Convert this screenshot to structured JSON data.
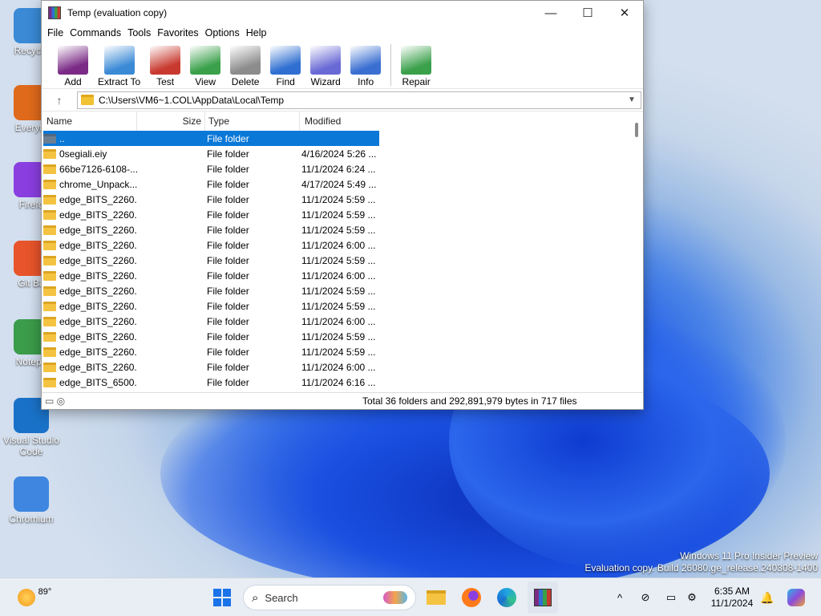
{
  "desktop": {
    "icons": [
      {
        "label": "Recycle",
        "icon": "recycle-bin-icon"
      },
      {
        "label": "Everyth",
        "icon": "everything-search-icon"
      },
      {
        "label": "Firefo",
        "icon": "firefox-icon"
      },
      {
        "label": "Git Ba",
        "icon": "git-bash-icon"
      },
      {
        "label": "Notepa",
        "icon": "notepad-icon"
      },
      {
        "label": "Visual Studio Code",
        "icon": "vscode-icon"
      },
      {
        "label": "Chromium",
        "icon": "chromium-icon"
      }
    ],
    "watermark_line1": "Windows 11 Pro Insider Preview",
    "watermark_line2": "Evaluation copy. Build 26080.ge_release.240308-1400"
  },
  "window": {
    "title": "Temp (evaluation copy)",
    "controls": {
      "minimize": "—",
      "maximize": "☐",
      "close": "✕"
    },
    "menu": [
      "File",
      "Commands",
      "Tools",
      "Favorites",
      "Options",
      "Help"
    ],
    "toolbar": [
      {
        "label": "Add",
        "icon": "add-archive-icon"
      },
      {
        "label": "Extract To",
        "icon": "extract-icon"
      },
      {
        "label": "Test",
        "icon": "test-icon"
      },
      {
        "label": "View",
        "icon": "view-book-icon"
      },
      {
        "label": "Delete",
        "icon": "trash-icon"
      },
      {
        "label": "Find",
        "icon": "magnifier-icon"
      },
      {
        "label": "Wizard",
        "icon": "wizard-wand-icon"
      },
      {
        "label": "Info",
        "icon": "info-icon"
      },
      {
        "label": "Repair",
        "icon": "repair-icon"
      }
    ],
    "address": "C:\\Users\\VM6~1.COL\\AppData\\Local\\Temp",
    "columns": {
      "name": "Name",
      "size": "Size",
      "type": "Type",
      "modified": "Modified"
    },
    "files": [
      {
        "name": "..",
        "size": "",
        "type": "File folder",
        "modified": "",
        "selected": true
      },
      {
        "name": "0segiali.eiy",
        "size": "",
        "type": "File folder",
        "modified": "4/16/2024 5:26 ..."
      },
      {
        "name": "66be7126-6108-...",
        "size": "",
        "type": "File folder",
        "modified": "11/1/2024 6:24 ..."
      },
      {
        "name": "chrome_Unpack...",
        "size": "",
        "type": "File folder",
        "modified": "4/17/2024 5:49 ..."
      },
      {
        "name": "edge_BITS_2260...",
        "size": "",
        "type": "File folder",
        "modified": "11/1/2024 5:59 ..."
      },
      {
        "name": "edge_BITS_2260...",
        "size": "",
        "type": "File folder",
        "modified": "11/1/2024 5:59 ..."
      },
      {
        "name": "edge_BITS_2260...",
        "size": "",
        "type": "File folder",
        "modified": "11/1/2024 5:59 ..."
      },
      {
        "name": "edge_BITS_2260...",
        "size": "",
        "type": "File folder",
        "modified": "11/1/2024 6:00 ..."
      },
      {
        "name": "edge_BITS_2260...",
        "size": "",
        "type": "File folder",
        "modified": "11/1/2024 5:59 ..."
      },
      {
        "name": "edge_BITS_2260...",
        "size": "",
        "type": "File folder",
        "modified": "11/1/2024 6:00 ..."
      },
      {
        "name": "edge_BITS_2260...",
        "size": "",
        "type": "File folder",
        "modified": "11/1/2024 5:59 ..."
      },
      {
        "name": "edge_BITS_2260...",
        "size": "",
        "type": "File folder",
        "modified": "11/1/2024 5:59 ..."
      },
      {
        "name": "edge_BITS_2260...",
        "size": "",
        "type": "File folder",
        "modified": "11/1/2024 6:00 ..."
      },
      {
        "name": "edge_BITS_2260...",
        "size": "",
        "type": "File folder",
        "modified": "11/1/2024 5:59 ..."
      },
      {
        "name": "edge_BITS_2260...",
        "size": "",
        "type": "File folder",
        "modified": "11/1/2024 5:59 ..."
      },
      {
        "name": "edge_BITS_2260...",
        "size": "",
        "type": "File folder",
        "modified": "11/1/2024 6:00 ..."
      },
      {
        "name": "edge_BITS_6500...",
        "size": "",
        "type": "File folder",
        "modified": "11/1/2024 6:16 ..."
      }
    ],
    "status": "Total 36 folders and 292,891,979 bytes in 717 files"
  },
  "taskbar": {
    "weather_temp": "89°",
    "search_placeholder": "Search",
    "time": "6:35 AM",
    "date": "11/1/2024",
    "pinned": [
      "start-icon",
      "file-explorer-icon",
      "firefox-icon",
      "edge-icon",
      "winrar-icon"
    ],
    "colors": {
      "selection": "#0a78d7",
      "folder": "#f5c342"
    }
  }
}
